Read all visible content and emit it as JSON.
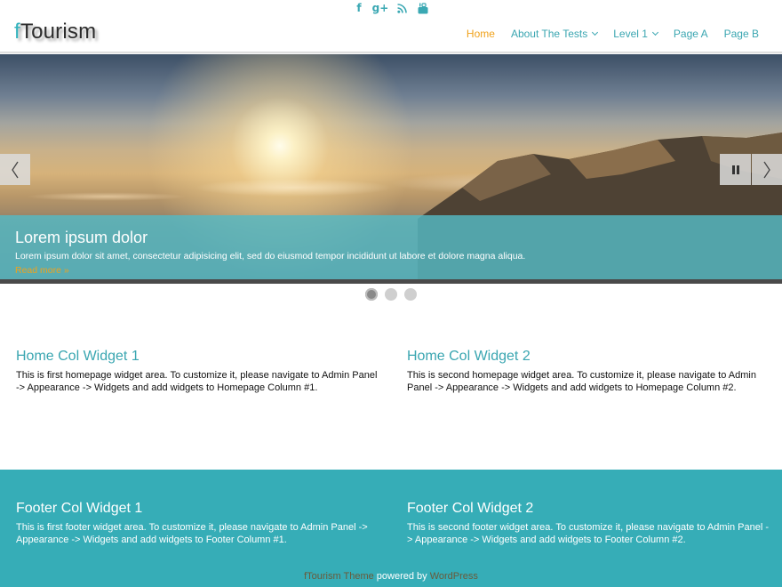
{
  "social": {
    "icons": [
      {
        "name": "facebook-icon",
        "glyph": "f"
      },
      {
        "name": "google-plus-icon",
        "glyph": "g+"
      },
      {
        "name": "rss-icon",
        "glyph": "))"
      },
      {
        "name": "youtube-icon",
        "glyph": "▶"
      }
    ]
  },
  "header": {
    "logo_first": "f",
    "logo_rest": "Tourism"
  },
  "nav": {
    "home": "Home",
    "about": "About The Tests",
    "level1": "Level 1",
    "page_a": "Page A",
    "page_b": "Page B"
  },
  "slider": {
    "title": "Lorem ipsum dolor",
    "text": "Lorem ipsum dolor sit amet, consectetur adipisicing elit, sed do eiusmod tempor incididunt ut labore et dolore magna aliqua.",
    "read_more": "Read more »",
    "active_slide": 1,
    "slide_count": 3
  },
  "home_widgets": {
    "col1": {
      "title": "Home Col Widget 1",
      "text": "This is first homepage widget area. To customize it, please navigate to Admin Panel -> Appearance -> Widgets and add widgets to Homepage Column #1."
    },
    "col2": {
      "title": "Home Col Widget 2",
      "text": "This is second homepage widget area. To customize it, please navigate to Admin Panel -> Appearance -> Widgets and add widgets to Homepage Column #2."
    }
  },
  "footer": {
    "col1": {
      "title": "Footer Col Widget 1",
      "text": "This is first footer widget area. To customize it, please navigate to Admin Panel -> Appearance -> Widgets and add widgets to Footer Column #1."
    },
    "col2": {
      "title": "Footer Col Widget 2",
      "text": "This is second footer widget area. To customize it, please navigate to Admin Panel -> Appearance -> Widgets and add widgets to Footer Column #2."
    },
    "credit_theme": "fTourism Theme",
    "credit_mid": " powered by ",
    "credit_wp": "WordPress"
  },
  "colors": {
    "accent": "#3aa6b1",
    "active_nav": "#f0a21b",
    "footer_bg": "#36adb7"
  }
}
